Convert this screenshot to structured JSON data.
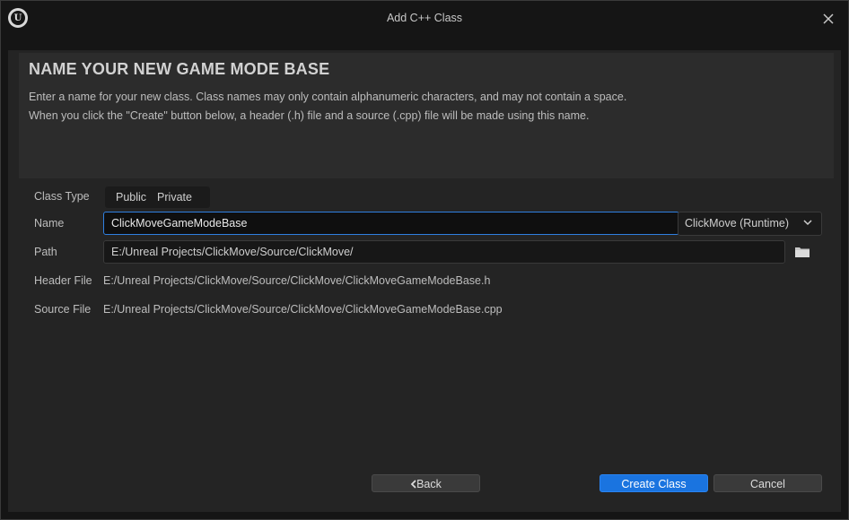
{
  "window": {
    "title": "Add C++ Class",
    "logo_letter": "U"
  },
  "header": {
    "heading": "NAME YOUR NEW GAME MODE BASE",
    "line1": "Enter a name for your new class. Class names may only contain alphanumeric characters, and may not contain a space.",
    "line2": "When you click the \"Create\" button below, a header (.h) file and a source (.cpp) file will be made using this name."
  },
  "form": {
    "class_type_label": "Class Type",
    "class_type_options": [
      "Public",
      "Private"
    ],
    "name_label": "Name",
    "name_value": "ClickMoveGameModeBase",
    "module_value": "ClickMove (Runtime)",
    "path_label": "Path",
    "path_value": "E:/Unreal Projects/ClickMove/Source/ClickMove/",
    "header_file_label": "Header File",
    "header_file_value": "E:/Unreal Projects/ClickMove/Source/ClickMove/ClickMoveGameModeBase.h",
    "source_file_label": "Source File",
    "source_file_value": "E:/Unreal Projects/ClickMove/Source/ClickMove/ClickMoveGameModeBase.cpp"
  },
  "buttons": {
    "back": "Back",
    "create": "Create Class",
    "cancel": "Cancel"
  },
  "icons": {
    "close": "close-icon",
    "folder": "folder-icon",
    "chevron": "chevron-down-icon",
    "back": "chevron-left-icon"
  },
  "colors": {
    "accent": "#1a74e0",
    "focus_border": "#2f7fe0",
    "panel": "#242424",
    "background": "#151515"
  }
}
